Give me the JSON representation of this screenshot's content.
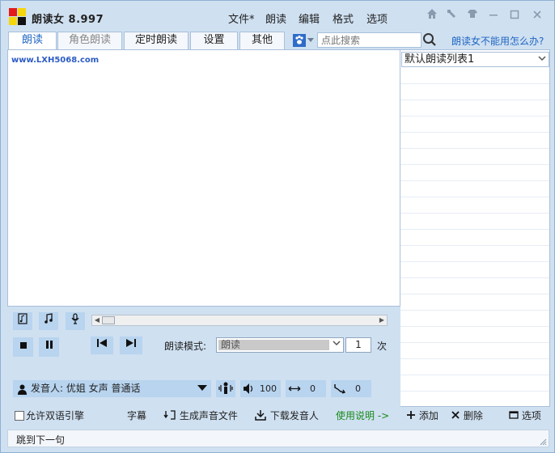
{
  "app": {
    "title": "朗读女  8.997"
  },
  "menu": [
    "文件*",
    "朗读",
    "编辑",
    "格式",
    "选项"
  ],
  "tabs": [
    "朗读",
    "角色朗读",
    "定时朗读",
    "设置",
    "其他"
  ],
  "search": {
    "placeholder": "点此搜索"
  },
  "help_link": "朗读女不能用怎么办?",
  "editor": {
    "text": "www.LXH5068.com"
  },
  "playlist": {
    "selected": "默认朗读列表1"
  },
  "mode": {
    "label": "朗读模式:",
    "value": "朗读",
    "count": "1",
    "count_unit": "次"
  },
  "voice": {
    "label": "发音人: 优姐 女声 普通话"
  },
  "volume": "100",
  "speed": "0",
  "pitch": "0",
  "bottom": {
    "checkbox_label": "允许双语引擎",
    "subtitle": "字幕",
    "generate_audio": "生成声音文件",
    "download_voice": "下载发音人",
    "instructions": "使用说明 ->",
    "add": "添加",
    "delete": "删除",
    "options": "选项"
  },
  "status": {
    "text": "跳到下一句"
  },
  "colors": {
    "accent": "#1f66c2",
    "link_green": "#1a8a1a",
    "panel_bg": "#cfe0f1",
    "button_bg": "#b8d4ef"
  }
}
